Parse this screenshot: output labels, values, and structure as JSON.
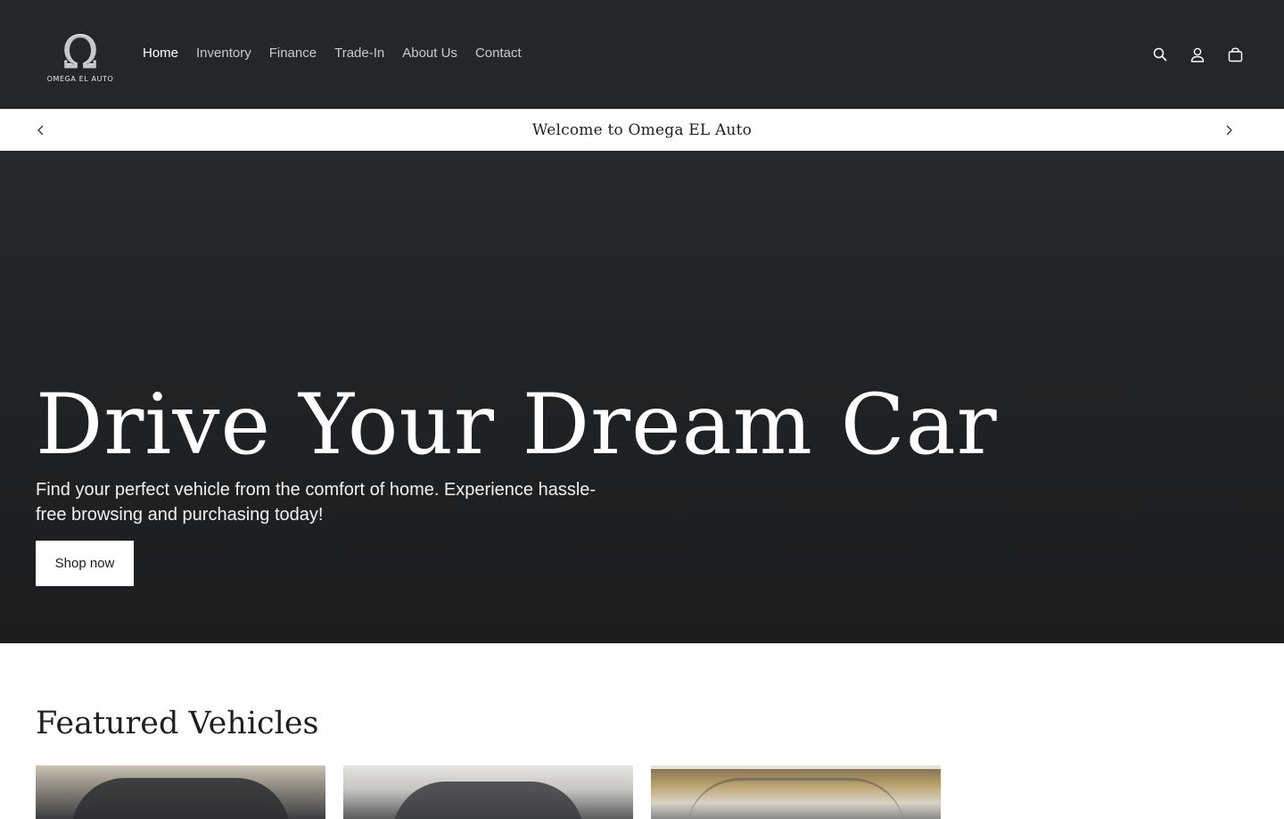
{
  "header": {
    "logo_mark": "Ω",
    "logo_text": "OMEGA EL AUTO",
    "nav": [
      {
        "label": "Home",
        "active": true
      },
      {
        "label": "Inventory"
      },
      {
        "label": "Finance"
      },
      {
        "label": "Trade-In"
      },
      {
        "label": "About Us"
      },
      {
        "label": "Contact"
      }
    ],
    "icons": [
      "search-icon",
      "account-icon",
      "cart-icon"
    ]
  },
  "announcement": {
    "text": "Welcome to Omega EL Auto"
  },
  "hero": {
    "title": "Drive Your Dream Car",
    "subtitle": "Find your perfect vehicle from the comfort of home. Experience hassle-free browsing and purchasing today!",
    "button_label": "Shop now"
  },
  "featured": {
    "title": "Featured Vehicles"
  },
  "colors": {
    "header_bg": "#23272a",
    "hero_bg": "#1f2224",
    "button_bg": "#ffffff"
  }
}
